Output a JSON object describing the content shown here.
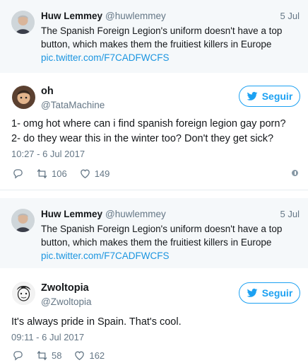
{
  "quote_1": {
    "name": "Huw Lemmey",
    "handle": "@huwlemmey",
    "date": "5 Jul",
    "text": "The Spanish Foreign Legion's uniform doesn't have a top button, which makes them the fruitiest killers in Europe",
    "link": "pic.twitter.com/F7CADFWCFS"
  },
  "tweet_1": {
    "name": "oh",
    "handle": "@TataMachine",
    "follow_label": "Seguir",
    "line_1": "1- omg hot where can i find spanish foreign legion gay porn?",
    "line_2": "2- do they wear this in the winter too? Don't they get sick?",
    "timestamp": "10:27 - 6 Jul 2017",
    "retweets": "106",
    "likes": "149"
  },
  "quote_2": {
    "name": "Huw Lemmey",
    "handle": "@huwlemmey",
    "date": "5 Jul",
    "text": "The Spanish Foreign Legion's uniform doesn't have a top button, which makes them the fruitiest killers in Europe",
    "link": "pic.twitter.com/F7CADFWCFS"
  },
  "tweet_2": {
    "name": "Zwoltopia",
    "handle": "@Zwoltopia",
    "follow_label": "Seguir",
    "text": "It's always pride in Spain. That's cool.",
    "timestamp": "09:11 - 6 Jul 2017",
    "retweets": "58",
    "likes": "162"
  },
  "colors": {
    "accent": "#1da1f2",
    "link": "#1b95e0",
    "muted": "#657786",
    "quote_bg": "#f5f8fa"
  },
  "icons": [
    "reply-icon",
    "retweet-icon",
    "like-icon",
    "twitter-bird-icon",
    "info-icon"
  ]
}
